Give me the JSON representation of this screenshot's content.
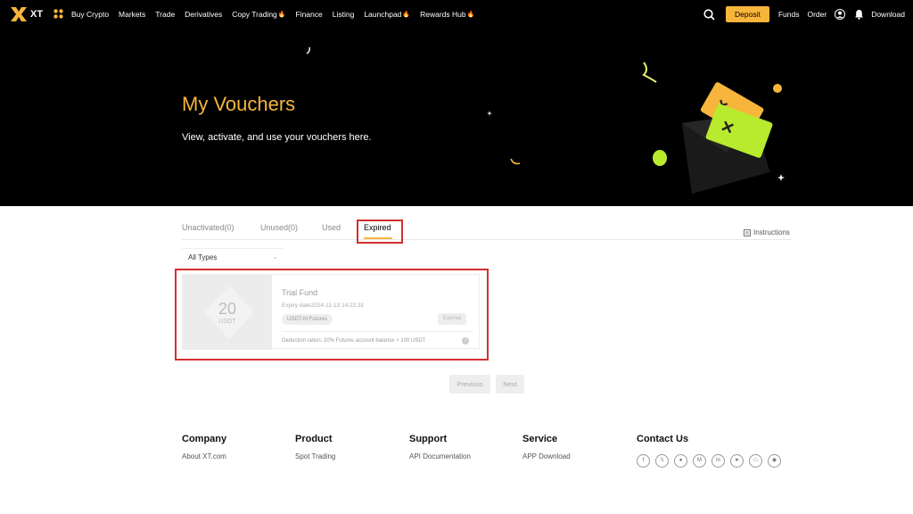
{
  "nav": {
    "logo_text": "XT",
    "links": [
      {
        "label": "Buy Crypto",
        "hot": false
      },
      {
        "label": "Markets",
        "hot": false
      },
      {
        "label": "Trade",
        "hot": false
      },
      {
        "label": "Derivatives",
        "hot": false
      },
      {
        "label": "Copy Trading",
        "hot": true
      },
      {
        "label": "Finance",
        "hot": false
      },
      {
        "label": "Listing",
        "hot": false
      },
      {
        "label": "Launchpad",
        "hot": true
      },
      {
        "label": "Rewards Hub",
        "hot": true
      }
    ],
    "deposit": "Deposit",
    "funds": "Funds",
    "order": "Order",
    "download": "Download"
  },
  "hero": {
    "title": "My Vouchers",
    "subtitle": "View, activate, and use your vouchers here."
  },
  "tabs": {
    "unactivated": "Unactivated(0)",
    "unused": "Unused(0)",
    "used": "Used",
    "expired": "Expired"
  },
  "instructions": "Instructions",
  "filter": {
    "selected": "All Types"
  },
  "voucher": {
    "amount": "20",
    "unit": "USDT",
    "title": "Trial Fund",
    "expiry": "Expiry date2024-11-13 14:22:31",
    "tag": "USDT-M Futures",
    "status": "Expired",
    "footer": "Deduction ration: 20%   Futures account balance > 100 USDT"
  },
  "pagination": {
    "prev": "Previous",
    "next": "Next"
  },
  "footer": {
    "company": {
      "title": "Company",
      "link": "About XT.com"
    },
    "product": {
      "title": "Product",
      "link": "Spot Trading"
    },
    "support": {
      "title": "Support",
      "link": "API Documentation"
    },
    "service": {
      "title": "Service",
      "link": "APP Download"
    },
    "contact": {
      "title": "Contact Us"
    }
  },
  "social_icons": [
    "facebook-icon",
    "x-icon",
    "reddit-icon",
    "medium-icon",
    "linkedin-icon",
    "telegram-icon",
    "instagram-icon",
    "discord-icon"
  ],
  "colors": {
    "accent": "#f7b53c",
    "highlight": "#d32f2f"
  }
}
